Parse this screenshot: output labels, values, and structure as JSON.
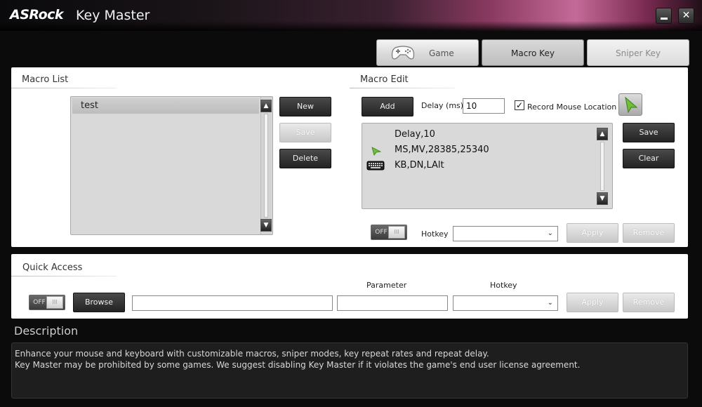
{
  "app": {
    "logo": "ASRock",
    "title": "Key Master"
  },
  "tabs": [
    {
      "label": "Game"
    },
    {
      "label": "Macro Key"
    },
    {
      "label": "Sniper Key"
    }
  ],
  "macro_list": {
    "title": "Macro List",
    "items": [
      "test"
    ],
    "new_label": "New",
    "save_label": "Save",
    "delete_label": "Delete"
  },
  "macro_edit": {
    "title": "Macro Edit",
    "add_label": "Add",
    "delay_label": "Delay (ms)",
    "delay_value": "10",
    "record_mouse_label": "Record Mouse Location",
    "record_mouse_checked": true,
    "lines": [
      {
        "icon": "",
        "text": "Delay,10"
      },
      {
        "icon": "mouse-cursor-icon",
        "text": "MS,MV,28385,25340"
      },
      {
        "icon": "keyboard-icon",
        "text": "KB,DN,LAlt"
      }
    ],
    "save_label": "Save",
    "clear_label": "Clear",
    "toggle_state": "OFF",
    "hotkey_label": "Hotkey",
    "hotkey_value": "",
    "apply_label": "Apply",
    "remove_label": "Remove"
  },
  "quick_access": {
    "title": "Quick Access",
    "toggle_state": "OFF",
    "browse_label": "Browse",
    "path_value": "",
    "parameter_label": "Parameter",
    "parameter_value": "",
    "hotkey_label": "Hotkey",
    "hotkey_value": "",
    "apply_label": "Apply",
    "remove_label": "Remove"
  },
  "description": {
    "title": "Description",
    "lines": [
      "Enhance your mouse and keyboard with customizable macros, sniper modes, key repeat rates and repeat delay.",
      "Key Master may be prohibited by some games. We suggest disabling Key Master if it violates the game's end user license agreement."
    ]
  },
  "colors": {
    "accent": "#c46a98",
    "cursor_green": "#6fbf3a"
  }
}
